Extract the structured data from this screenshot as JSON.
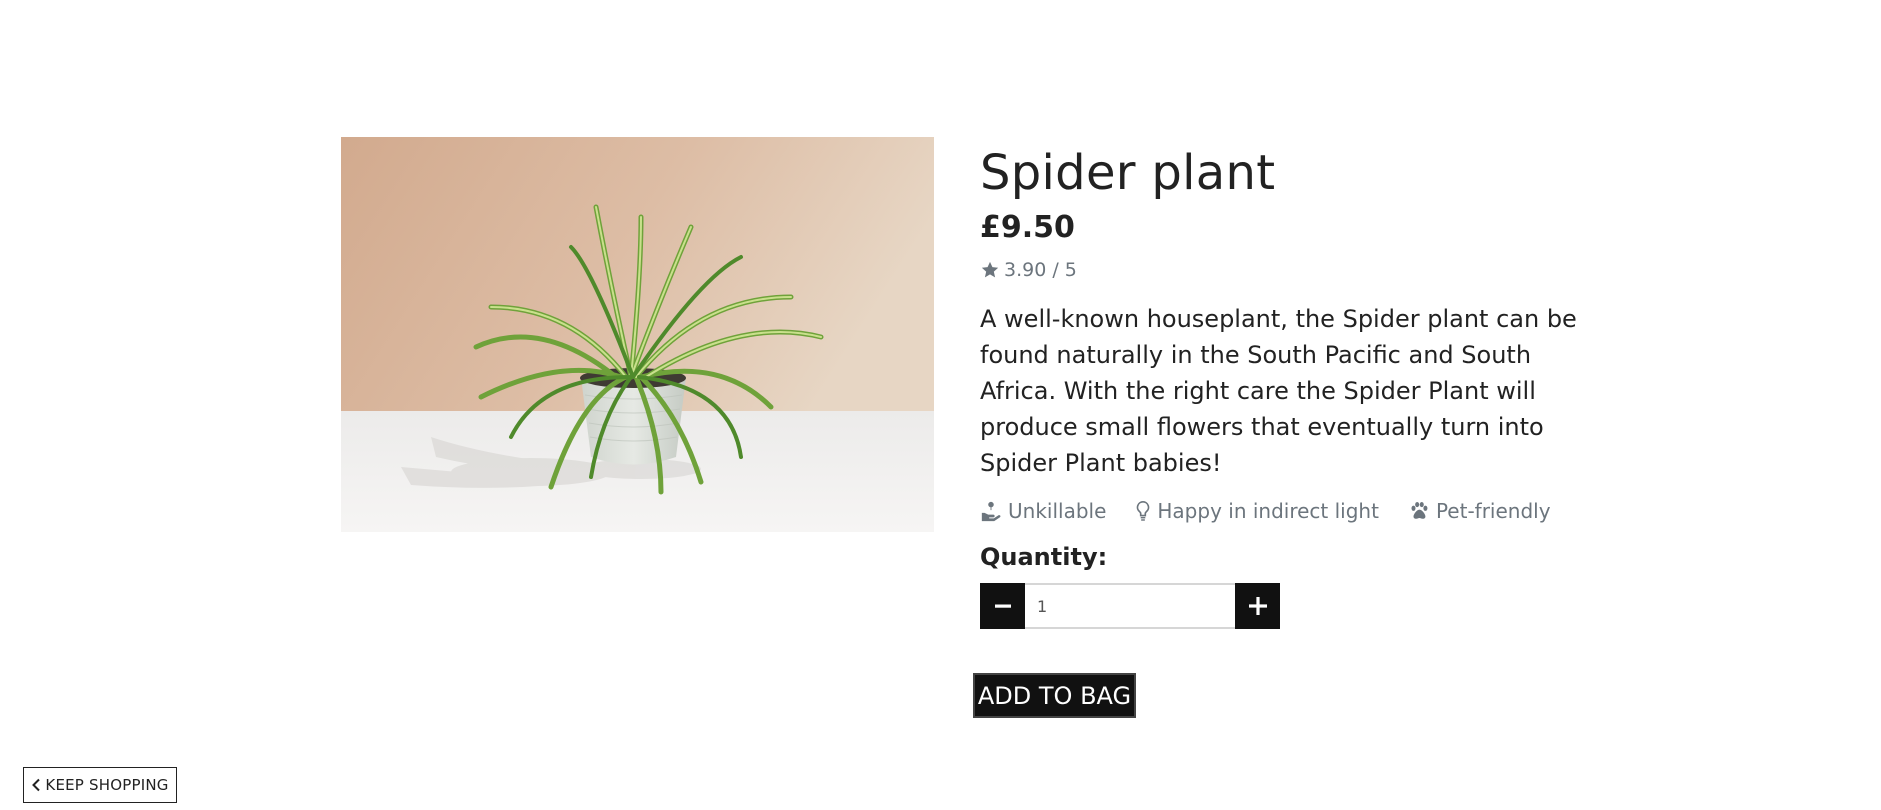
{
  "product": {
    "image_alt": "Spider plant in a white pot",
    "title": "Spider plant",
    "price": "£9.50",
    "rating": "3.90 / 5",
    "rating_icon": "star-icon",
    "description": "A well-known houseplant, the Spider plant can be found naturally in the South Pacific and South Africa. With the right care the Spider Plant will produce small flowers that eventually turn into Spider Plant babies!",
    "features": [
      {
        "icon": "hand-holding-seedling-icon",
        "label": "Unkillable"
      },
      {
        "icon": "lightbulb-icon",
        "label": "Happy in indirect light"
      },
      {
        "icon": "paw-icon",
        "label": "Pet-friendly"
      }
    ]
  },
  "quantity": {
    "label": "Quantity:",
    "value": "1",
    "decrement_icon": "minus-icon",
    "increment_icon": "plus-icon"
  },
  "actions": {
    "add_to_bag": "ADD TO BAG",
    "keep_shopping": "KEEP SHOPPING",
    "keep_shopping_icon": "chevron-left-icon"
  },
  "colors": {
    "text": "#222222",
    "muted": "#6c757d",
    "button_dark": "#111111",
    "image_wall": "#d9b49a",
    "image_table": "#f3f1ef"
  }
}
